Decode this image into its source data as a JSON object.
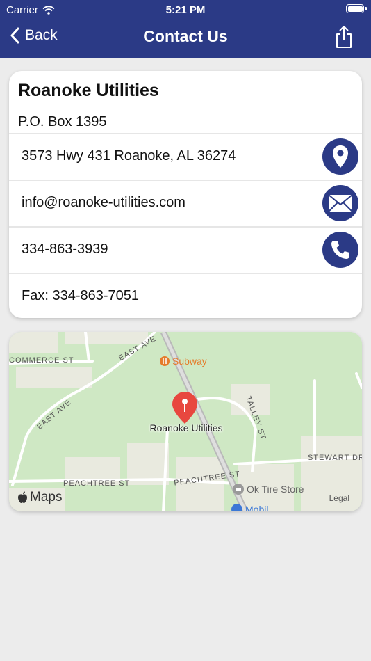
{
  "status_bar": {
    "carrier": "Carrier",
    "time": "5:21 PM"
  },
  "nav": {
    "back_label": "Back",
    "title": "Contact Us"
  },
  "contact": {
    "name": "Roanoke Utilities",
    "po_box": "P.O. Box 1395",
    "address": "3573 Hwy 431 Roanoke, AL 36274",
    "email": "info@roanoke-utilities.com",
    "phone": "334-863-3939",
    "fax": "Fax: 334-863-7051"
  },
  "map": {
    "pin_label": "Roanoke Utilities",
    "streets": {
      "commerce": "COMMERCE ST",
      "east_ave_1": "EAST AVE",
      "east_ave_2": "EAST AVE",
      "talley": "TALLEY ST",
      "stewart": "STEWART DR",
      "peachtree_1": "PEACHTREE ST",
      "peachtree_2": "PEACHTREE ST"
    },
    "poi": {
      "subway": "Subway",
      "tire": "Ok Tire Store",
      "mobil": "Mobil"
    },
    "maps_brand": "Maps",
    "legal": "Legal",
    "colors": {
      "pin": "#e8473f",
      "subway": "#e57b2a",
      "land": "#cfe8c4"
    }
  },
  "colors": {
    "accent": "#2b3a86",
    "background": "#ececec"
  }
}
